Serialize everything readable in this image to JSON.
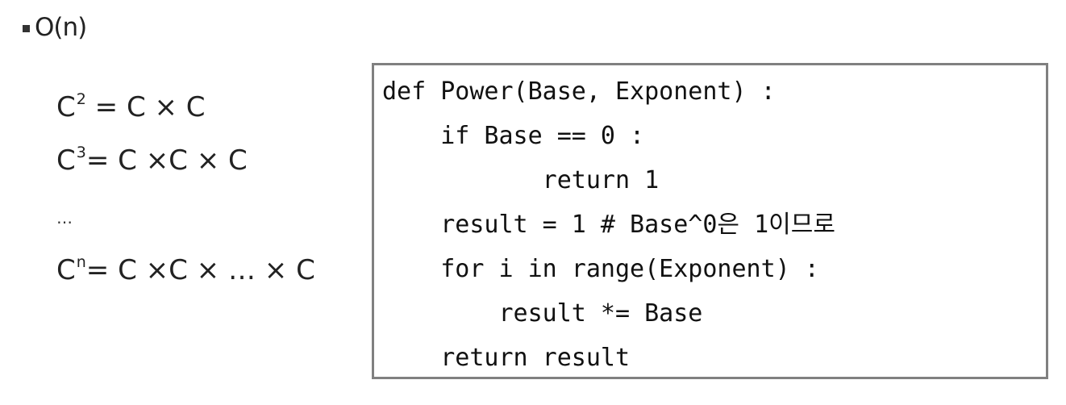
{
  "heading": {
    "bullet_icon": "square-bullet-icon",
    "text": "O(n)"
  },
  "equations": [
    {
      "base": "C",
      "exp": "2",
      "rhs": " = C × C"
    },
    {
      "base": "C",
      "exp": "3",
      "rhs": "= C ×C × C"
    },
    {
      "base": "C",
      "exp": "n",
      "rhs": "= C ×C × … × C"
    }
  ],
  "ellipsis": "…",
  "code": {
    "lines": [
      "def Power(Base, Exponent) :",
      "    if Base == 0 :",
      "           return 1",
      "    result = 1 # Base^0은 1이므로",
      "    for i in range(Exponent) :",
      "        result *= Base",
      "    return result"
    ]
  }
}
